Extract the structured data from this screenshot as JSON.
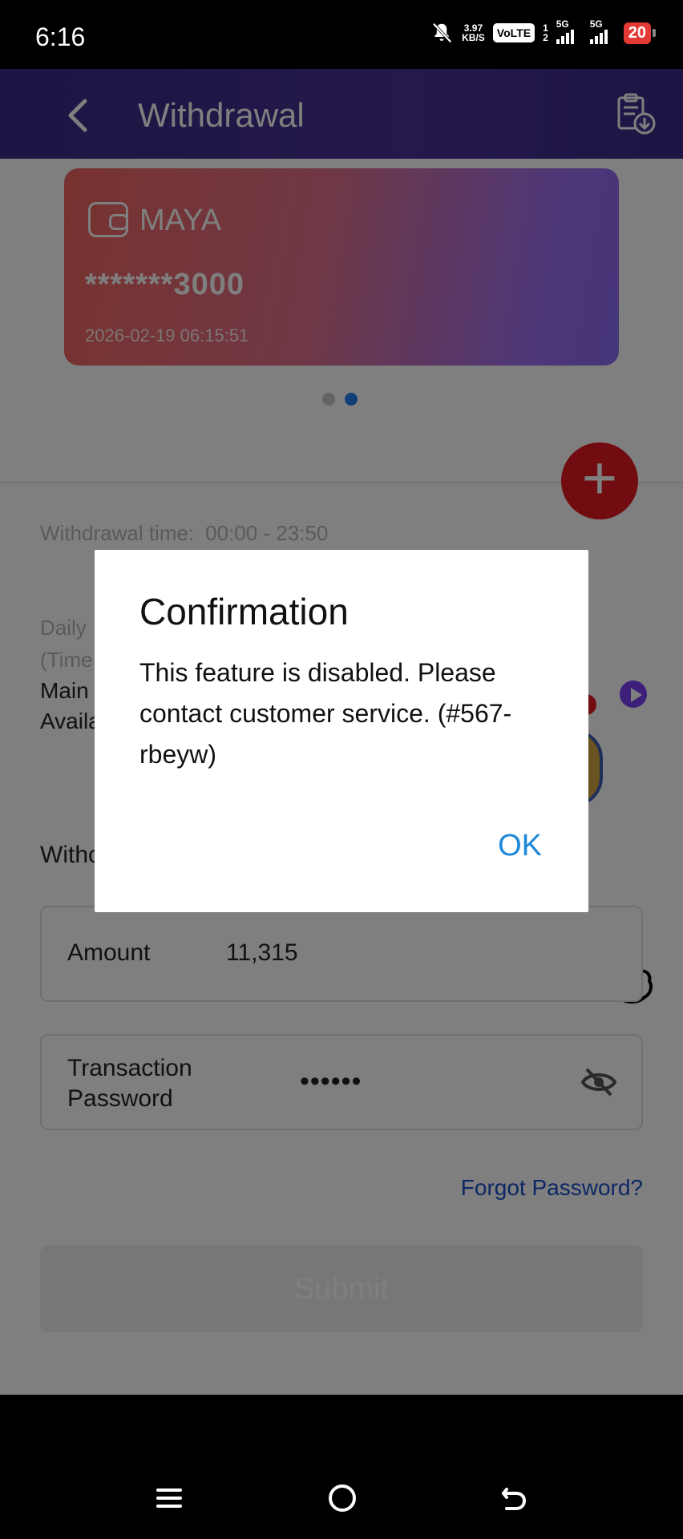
{
  "status_bar": {
    "time": "6:16",
    "net_speed_value": "3.97",
    "net_speed_unit": "KB/S",
    "volte": "VoLTE",
    "sim_labels": [
      "1",
      "2"
    ],
    "network_1": "5G",
    "network_2": "5G",
    "battery": "20",
    "icons": [
      "mute-bell-icon",
      "signal-icon",
      "battery-icon"
    ]
  },
  "header": {
    "title": "Withdrawal",
    "icons": [
      "back-arrow-icon",
      "withdrawal-history-icon"
    ]
  },
  "card": {
    "bank_name": "MAYA",
    "account_number": "*******3000",
    "date": "2026-02-19 06:15:51",
    "pages": 2,
    "active_page": 2,
    "colors": {
      "start": "#f0655f",
      "end": "#8c6cf3"
    }
  },
  "add_button": {
    "label": "+",
    "color": "#e31b23"
  },
  "info": {
    "withdrawal_time_label": "Withdrawal time:",
    "withdrawal_time_value": "00:00 - 23:50",
    "daily_partial": "Daily",
    "times_partial": "(Time",
    "main_partial": "Main",
    "available_partial": "Availa",
    "withdraw_partial": "Withc"
  },
  "form": {
    "amount_label": "Amount",
    "amount_value": "11,315",
    "password_label": "Transaction Password",
    "password_value": "••••••",
    "forgot_password": "Forgot Password?",
    "submit_label": "Submit"
  },
  "dialog": {
    "title": "Confirmation",
    "message": "This feature is disabled. Please contact customer service. (#567-rbeyw)",
    "ok_label": "OK",
    "accent_color": "#1e88d8"
  },
  "nav_bar": {
    "icons": [
      "menu-icon",
      "home-icon",
      "back-icon"
    ]
  }
}
